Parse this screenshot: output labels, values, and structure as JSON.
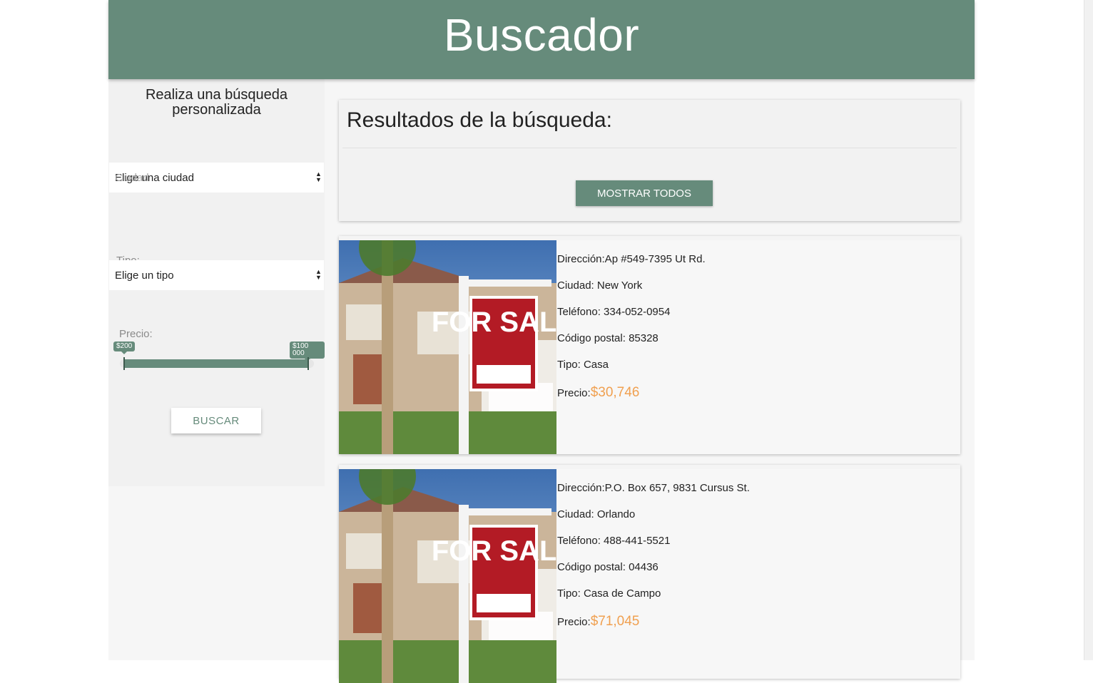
{
  "header": {
    "title": "Buscador"
  },
  "sidebar": {
    "intro": "Realiza una búsqueda personalizada",
    "city_select": {
      "label": "Ciudad",
      "value": "Elige una ciudad"
    },
    "type_select": {
      "label": "Tipo:",
      "value": "Elige un tipo"
    },
    "price": {
      "label": "Precio:",
      "min_label": "$200",
      "max_label": "$100 000"
    },
    "search_button": "BUSCAR"
  },
  "results": {
    "title": "Resultados de la búsqueda:",
    "show_all_button": "MOSTRAR TODOS"
  },
  "listings": [
    {
      "image_text": "FOR SALE",
      "address": "Dirección:Ap #549-7395 Ut Rd.",
      "city": "Ciudad: New York",
      "phone": "Teléfono: 334-052-0954",
      "zip": "Código postal: 85328",
      "type": "Tipo: Casa",
      "price_label": "Precio:",
      "price": "$30,746"
    },
    {
      "image_text": "FOR SALE",
      "address": "Dirección:P.O. Box 657, 9831 Cursus St.",
      "city": "Ciudad: Orlando",
      "phone": "Teléfono: 488-441-5521",
      "zip": "Código postal: 04436",
      "type": "Tipo: Casa de Campo",
      "price_label": "Precio:",
      "price": "$71,045"
    }
  ],
  "colors": {
    "accent": "#668b7b",
    "price": "#f0a050"
  }
}
